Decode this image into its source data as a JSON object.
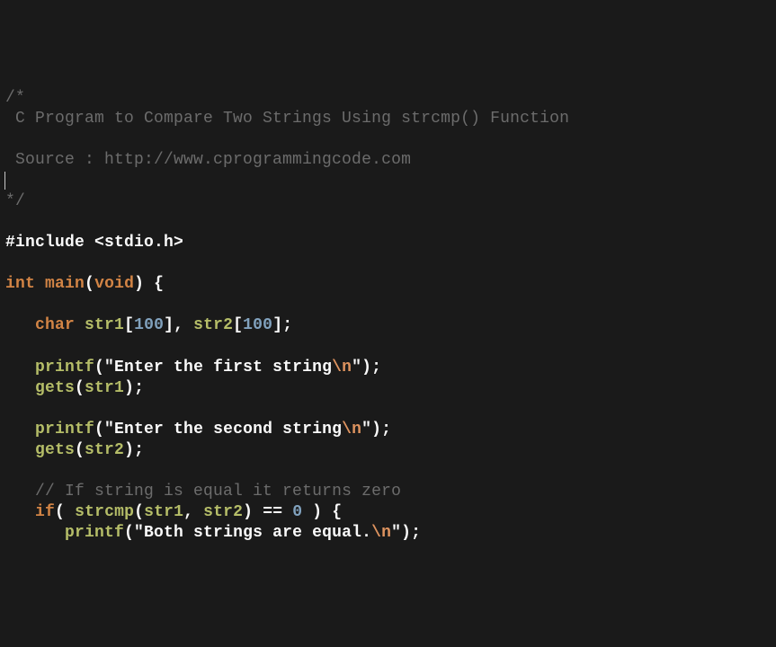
{
  "code": {
    "comment_open": "/*",
    "comment_title": " C Program to Compare Two Strings Using strcmp() Function",
    "blank1": "",
    "comment_source": " Source : http://www.cprogrammingcode.com",
    "comment_close": "*/",
    "include_directive": "#include",
    "include_header": "<stdio.h>",
    "kw_int": "int",
    "fn_main": "main",
    "kw_void": "void",
    "kw_char": "char",
    "id_str1": "str1",
    "id_str2": "str2",
    "arrsize1": "100",
    "arrsize2": "100",
    "fn_printf": "printf",
    "fn_gets": "gets",
    "fn_strcmp": "strcmp",
    "str_first_a": "\"Enter the first string",
    "str_second_a": "\"Enter the second string",
    "str_equal_a": "\"Both strings are equal.",
    "esc_n": "\\n",
    "str_close": "\"",
    "line_comment": "// If string is equal it returns zero",
    "kw_if": "if",
    "num_zero": "0",
    "op_eq": "=="
  }
}
